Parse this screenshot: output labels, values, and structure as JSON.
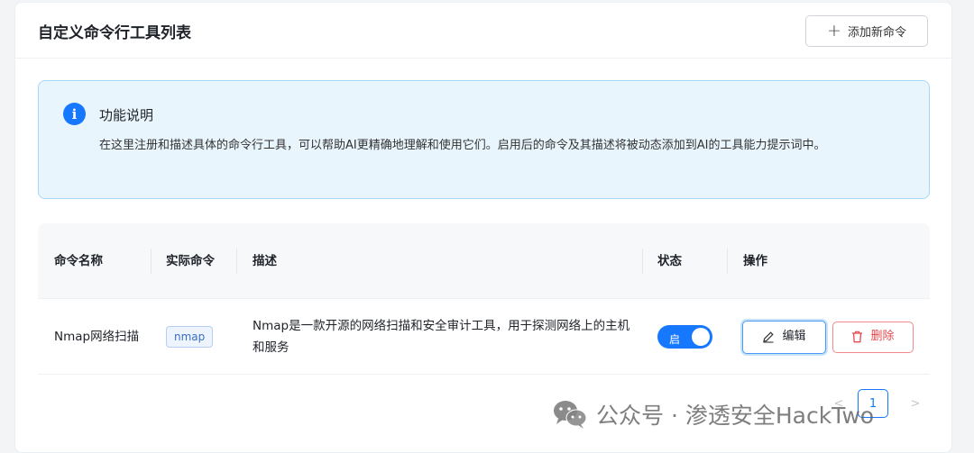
{
  "header": {
    "title": "自定义命令行工具列表",
    "add_button": "添加新命令"
  },
  "info": {
    "title": "功能说明",
    "text": "在这里注册和描述具体的命令行工具，可以帮助AI更精确地理解和使用它们。启用后的命令及其描述将被动态添加到AI的工具能力提示词中。"
  },
  "table": {
    "columns": {
      "name": "命令名称",
      "command": "实际命令",
      "description": "描述",
      "status": "状态",
      "actions": "操作"
    },
    "rows": [
      {
        "name": "Nmap网络扫描",
        "command": "nmap",
        "description": "Nmap是一款开源的网络扫描和安全审计工具，用于探测网络上的主机和服务",
        "status_label": "启",
        "enabled": true,
        "edit_label": "编辑",
        "delete_label": "删除"
      }
    ]
  },
  "pagination": {
    "prev": "<",
    "current": "1",
    "next": ">"
  },
  "watermark": {
    "text": "公众号 · 渗透安全HackTwo"
  },
  "colors": {
    "accent": "#1677ff",
    "danger": "#e5484d",
    "info_bg": "#e9f5fd"
  }
}
